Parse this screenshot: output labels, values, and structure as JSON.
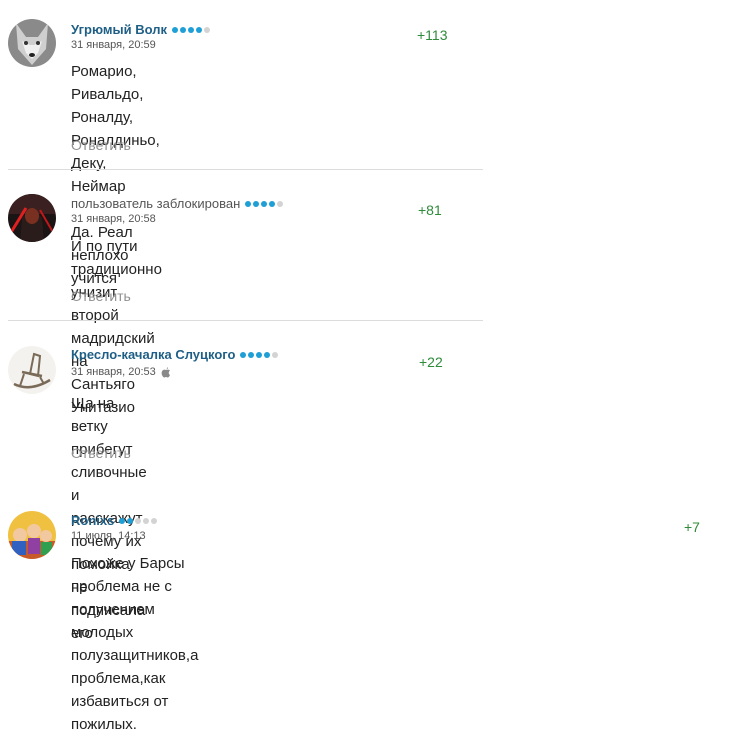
{
  "comments": [
    {
      "author": "Угрюмый Волк",
      "rating": [
        true,
        true,
        true,
        true,
        false
      ],
      "date": "31 января, 20:59",
      "score": "+113",
      "text": "Ромарио, Ривальдо, Роналду, Роналдиньо, Деку, Неймар\n\nДа. Реал неплохо учится",
      "reply": "Ответить",
      "avatar": "wolf"
    },
    {
      "author": "пользователь заблокирован",
      "rating": [
        true,
        true,
        true,
        true,
        false
      ],
      "date": "31 января, 20:58",
      "score": "+81",
      "text": "И по пути традиционно унизит второй мадридский на\nСантьяго Унитазио",
      "reply": "Ответить",
      "avatar": "dark-figure"
    },
    {
      "author": "Кресло-качалка Слуцкого",
      "rating": [
        true,
        true,
        true,
        true,
        false
      ],
      "date": "31 января, 20:53",
      "score": "+22",
      "text": "Ща на ветку прибегут сливочные и расскажут почему их\nпомойка не подписала его",
      "reply": "Ответить",
      "avatar": "rocking-chair",
      "device_icon": "apple-icon"
    },
    {
      "author": "Ronixs",
      "rating": [
        true,
        true,
        false,
        false,
        false
      ],
      "date": "11 июля, 14:13",
      "score": "+7",
      "text": "Похоже у Барсы проблема не с получением молодых полузащитников,а проблема,как\nизбавиться от пожилых.",
      "avatar": "cartoon-group"
    }
  ]
}
